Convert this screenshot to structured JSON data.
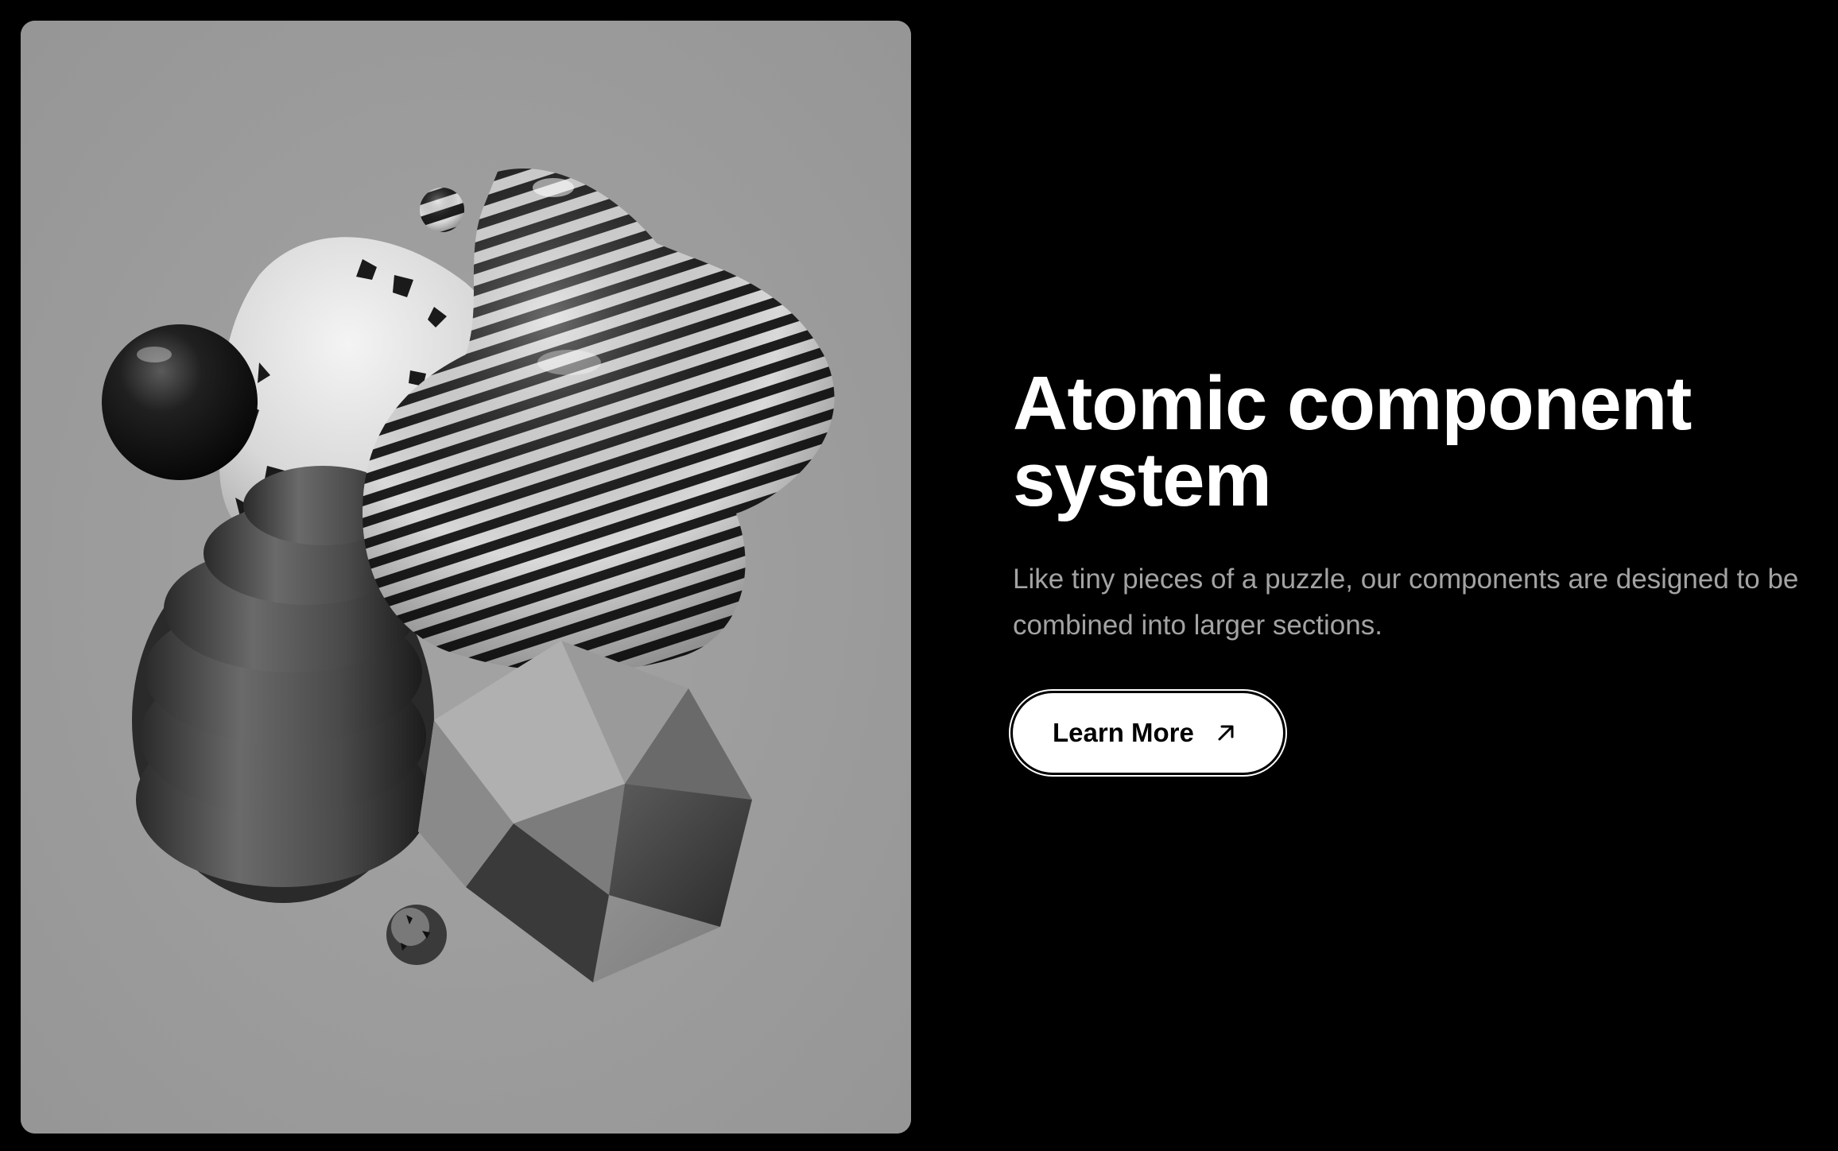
{
  "hero": {
    "title_line1": "Atomic component",
    "title_line2": "system",
    "description_line1": "Like tiny pieces of a puzzle, our components are designed to be",
    "description_line2": "combined into larger sections.",
    "cta_label": "Learn More",
    "cta_icon": "arrow-up-right-icon"
  },
  "colors": {
    "background": "#000000",
    "card_background": "#9c9c9c",
    "title": "#ffffff",
    "description": "#a3a3a3",
    "button_background": "#ffffff",
    "button_text": "#000000"
  }
}
